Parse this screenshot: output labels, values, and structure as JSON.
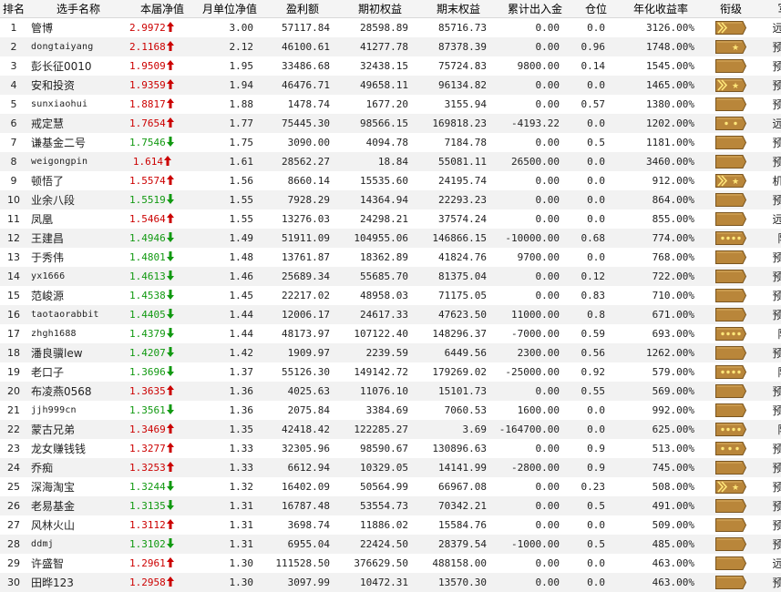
{
  "colors": {
    "up": "#cc0000",
    "down": "#119911",
    "badge_fill": "#b9863a",
    "badge_edge": "#7a5520",
    "badge_star": "#ffe77a"
  },
  "headers": [
    "排名",
    "选手名称",
    "本届净值",
    "月单位净值",
    "盈利额",
    "期初权益",
    "期末权益",
    "累计出入金",
    "仓位",
    "年化收益率",
    "衔级",
    "军种"
  ],
  "rows": [
    {
      "rank": "1",
      "name": "管博",
      "latin": false,
      "nav": "2.9972",
      "dir": "up",
      "monthly": "3.00",
      "profit": "57117.84",
      "start": "28598.89",
      "end": "85716.73",
      "cum": "0.00",
      "pos": "0.0",
      "ann": "3126.00%",
      "insignia": "chevrons-double",
      "branch": "远征军"
    },
    {
      "rank": "2",
      "name": "dongtaiyang",
      "latin": true,
      "nav": "2.1168",
      "dir": "up",
      "monthly": "2.12",
      "profit": "46100.61",
      "start": "41277.78",
      "end": "87378.39",
      "cum": "0.00",
      "pos": "0.96",
      "ann": "1748.00%",
      "insignia": "star-1",
      "branch": "预备役"
    },
    {
      "rank": "3",
      "name": "彭长征0010",
      "latin": false,
      "nav": "1.9509",
      "dir": "up",
      "monthly": "1.95",
      "profit": "33486.68",
      "start": "32438.15",
      "end": "75724.83",
      "cum": "9800.00",
      "pos": "0.14",
      "ann": "1545.00%",
      "insignia": "plain",
      "branch": "预备役"
    },
    {
      "rank": "4",
      "name": "安和投资",
      "latin": false,
      "nav": "1.9359",
      "dir": "up",
      "monthly": "1.94",
      "profit": "46476.71",
      "start": "49658.11",
      "end": "96134.82",
      "cum": "0.00",
      "pos": "0.0",
      "ann": "1465.00%",
      "insignia": "chevrons-star",
      "branch": "预备役"
    },
    {
      "rank": "5",
      "name": "sunxiaohui",
      "latin": true,
      "nav": "1.8817",
      "dir": "up",
      "monthly": "1.88",
      "profit": "1478.74",
      "start": "1677.20",
      "end": "3155.94",
      "cum": "0.00",
      "pos": "0.57",
      "ann": "1380.00%",
      "insignia": "plain",
      "branch": "预备役"
    },
    {
      "rank": "6",
      "name": "戒定慧",
      "latin": false,
      "nav": "1.7654",
      "dir": "up",
      "monthly": "1.77",
      "profit": "75445.30",
      "start": "98566.15",
      "end": "169818.23",
      "cum": "-4193.22",
      "pos": "0.0",
      "ann": "1202.00%",
      "insignia": "dots-2",
      "branch": "远征军"
    },
    {
      "rank": "7",
      "name": "谦基金二号",
      "latin": false,
      "nav": "1.7546",
      "dir": "down",
      "monthly": "1.75",
      "profit": "3090.00",
      "start": "4094.78",
      "end": "7184.78",
      "cum": "0.00",
      "pos": "0.5",
      "ann": "1181.00%",
      "insignia": "plain",
      "branch": "预备役"
    },
    {
      "rank": "8",
      "name": "weigongpin",
      "latin": true,
      "nav": "1.614",
      "dir": "up",
      "monthly": "1.61",
      "profit": "28562.27",
      "start": "18.84",
      "end": "55081.11",
      "cum": "26500.00",
      "pos": "0.0",
      "ann": "3460.00%",
      "insignia": "plain",
      "branch": "预备役"
    },
    {
      "rank": "9",
      "name": "顿悟了",
      "latin": false,
      "nav": "1.5574",
      "dir": "up",
      "monthly": "1.56",
      "profit": "8660.14",
      "start": "15535.60",
      "end": "24195.74",
      "cum": "0.00",
      "pos": "0.0",
      "ann": "912.00%",
      "insignia": "chevrons-star",
      "branch": "机枪手"
    },
    {
      "rank": "10",
      "name": "业余八段",
      "latin": false,
      "nav": "1.5519",
      "dir": "down",
      "monthly": "1.55",
      "profit": "7928.29",
      "start": "14364.94",
      "end": "22293.23",
      "cum": "0.00",
      "pos": "0.0",
      "ann": "864.00%",
      "insignia": "plain",
      "branch": "预备役"
    },
    {
      "rank": "11",
      "name": "凤凰",
      "latin": false,
      "nav": "1.5464",
      "dir": "up",
      "monthly": "1.55",
      "profit": "13276.03",
      "start": "24298.21",
      "end": "37574.24",
      "cum": "0.00",
      "pos": "0.0",
      "ann": "855.00%",
      "insignia": "plain",
      "branch": "远征军"
    },
    {
      "rank": "12",
      "name": "王建昌",
      "latin": false,
      "nav": "1.4946",
      "dir": "down",
      "monthly": "1.49",
      "profit": "51911.09",
      "start": "104955.06",
      "end": "146866.15",
      "cum": "-10000.00",
      "pos": "0.68",
      "ann": "774.00%",
      "insignia": "dots-4",
      "branch": "陆军"
    },
    {
      "rank": "13",
      "name": "于秀伟",
      "latin": false,
      "nav": "1.4801",
      "dir": "down",
      "monthly": "1.48",
      "profit": "13761.87",
      "start": "18362.89",
      "end": "41824.76",
      "cum": "9700.00",
      "pos": "0.0",
      "ann": "768.00%",
      "insignia": "plain",
      "branch": "预备役"
    },
    {
      "rank": "14",
      "name": "yx1666",
      "latin": true,
      "nav": "1.4613",
      "dir": "down",
      "monthly": "1.46",
      "profit": "25689.34",
      "start": "55685.70",
      "end": "81375.04",
      "cum": "0.00",
      "pos": "0.12",
      "ann": "722.00%",
      "insignia": "plain",
      "branch": "预备役"
    },
    {
      "rank": "15",
      "name": "范峻源",
      "latin": false,
      "nav": "1.4538",
      "dir": "down",
      "monthly": "1.45",
      "profit": "22217.02",
      "start": "48958.03",
      "end": "71175.05",
      "cum": "0.00",
      "pos": "0.83",
      "ann": "710.00%",
      "insignia": "plain",
      "branch": "预备役"
    },
    {
      "rank": "16",
      "name": "taotaorabbit",
      "latin": true,
      "nav": "1.4405",
      "dir": "down",
      "monthly": "1.44",
      "profit": "12006.17",
      "start": "24617.33",
      "end": "47623.50",
      "cum": "11000.00",
      "pos": "0.8",
      "ann": "671.00%",
      "insignia": "plain",
      "branch": "预备役"
    },
    {
      "rank": "17",
      "name": "zhgh1688",
      "latin": true,
      "nav": "1.4379",
      "dir": "down",
      "monthly": "1.44",
      "profit": "48173.97",
      "start": "107122.40",
      "end": "148296.37",
      "cum": "-7000.00",
      "pos": "0.59",
      "ann": "693.00%",
      "insignia": "dots-4",
      "branch": "陆军"
    },
    {
      "rank": "18",
      "name": "潘良骥lew",
      "latin": false,
      "nav": "1.4207",
      "dir": "down",
      "monthly": "1.42",
      "profit": "1909.97",
      "start": "2239.59",
      "end": "6449.56",
      "cum": "2300.00",
      "pos": "0.56",
      "ann": "1262.00%",
      "insignia": "plain",
      "branch": "预备役"
    },
    {
      "rank": "19",
      "name": "老口子",
      "latin": false,
      "nav": "1.3696",
      "dir": "down",
      "monthly": "1.37",
      "profit": "55126.30",
      "start": "149142.72",
      "end": "179269.02",
      "cum": "-25000.00",
      "pos": "0.92",
      "ann": "579.00%",
      "insignia": "dots-4",
      "branch": "陆军"
    },
    {
      "rank": "20",
      "name": "布凌燕0568",
      "latin": false,
      "nav": "1.3635",
      "dir": "up",
      "monthly": "1.36",
      "profit": "4025.63",
      "start": "11076.10",
      "end": "15101.73",
      "cum": "0.00",
      "pos": "0.55",
      "ann": "569.00%",
      "insignia": "plain",
      "branch": "预备役"
    },
    {
      "rank": "21",
      "name": "jjh999cn",
      "latin": true,
      "nav": "1.3561",
      "dir": "down",
      "monthly": "1.36",
      "profit": "2075.84",
      "start": "3384.69",
      "end": "7060.53",
      "cum": "1600.00",
      "pos": "0.0",
      "ann": "992.00%",
      "insignia": "plain",
      "branch": "预备役"
    },
    {
      "rank": "22",
      "name": "蒙古兄弟",
      "latin": false,
      "nav": "1.3469",
      "dir": "up",
      "monthly": "1.35",
      "profit": "42418.42",
      "start": "122285.27",
      "end": "3.69",
      "cum": "-164700.00",
      "pos": "0.0",
      "ann": "625.00%",
      "insignia": "dots-4",
      "branch": "陆军"
    },
    {
      "rank": "23",
      "name": "龙女赚钱钱",
      "latin": false,
      "nav": "1.3277",
      "dir": "up",
      "monthly": "1.33",
      "profit": "32305.96",
      "start": "98590.67",
      "end": "130896.63",
      "cum": "0.00",
      "pos": "0.9",
      "ann": "513.00%",
      "insignia": "dots-3",
      "branch": "预备役"
    },
    {
      "rank": "24",
      "name": "乔痴",
      "latin": false,
      "nav": "1.3253",
      "dir": "up",
      "monthly": "1.33",
      "profit": "6612.94",
      "start": "10329.05",
      "end": "14141.99",
      "cum": "-2800.00",
      "pos": "0.9",
      "ann": "745.00%",
      "insignia": "plain",
      "branch": "预备役"
    },
    {
      "rank": "25",
      "name": "深海淘宝",
      "latin": false,
      "nav": "1.3244",
      "dir": "down",
      "monthly": "1.32",
      "profit": "16402.09",
      "start": "50564.99",
      "end": "66967.08",
      "cum": "0.00",
      "pos": "0.23",
      "ann": "508.00%",
      "insignia": "chevrons-star",
      "branch": "预备役"
    },
    {
      "rank": "26",
      "name": "老易基金",
      "latin": false,
      "nav": "1.3135",
      "dir": "down",
      "monthly": "1.31",
      "profit": "16787.48",
      "start": "53554.73",
      "end": "70342.21",
      "cum": "0.00",
      "pos": "0.5",
      "ann": "491.00%",
      "insignia": "plain",
      "branch": "预备役"
    },
    {
      "rank": "27",
      "name": "风林火山",
      "latin": false,
      "nav": "1.3112",
      "dir": "up",
      "monthly": "1.31",
      "profit": "3698.74",
      "start": "11886.02",
      "end": "15584.76",
      "cum": "0.00",
      "pos": "0.0",
      "ann": "509.00%",
      "insignia": "plain",
      "branch": "预备役"
    },
    {
      "rank": "28",
      "name": "ddmj",
      "latin": true,
      "nav": "1.3102",
      "dir": "down",
      "monthly": "1.31",
      "profit": "6955.04",
      "start": "22424.50",
      "end": "28379.54",
      "cum": "-1000.00",
      "pos": "0.5",
      "ann": "485.00%",
      "insignia": "plain",
      "branch": "预备役"
    },
    {
      "rank": "29",
      "name": "许盛智",
      "latin": false,
      "nav": "1.2961",
      "dir": "up",
      "monthly": "1.30",
      "profit": "111528.50",
      "start": "376629.50",
      "end": "488158.00",
      "cum": "0.00",
      "pos": "0.0",
      "ann": "463.00%",
      "insignia": "plain",
      "branch": "远征军"
    },
    {
      "rank": "30",
      "name": "田晔123",
      "latin": false,
      "nav": "1.2958",
      "dir": "up",
      "monthly": "1.30",
      "profit": "3097.99",
      "start": "10472.31",
      "end": "13570.30",
      "cum": "0.00",
      "pos": "0.0",
      "ann": "463.00%",
      "insignia": "plain",
      "branch": "预备役"
    }
  ]
}
